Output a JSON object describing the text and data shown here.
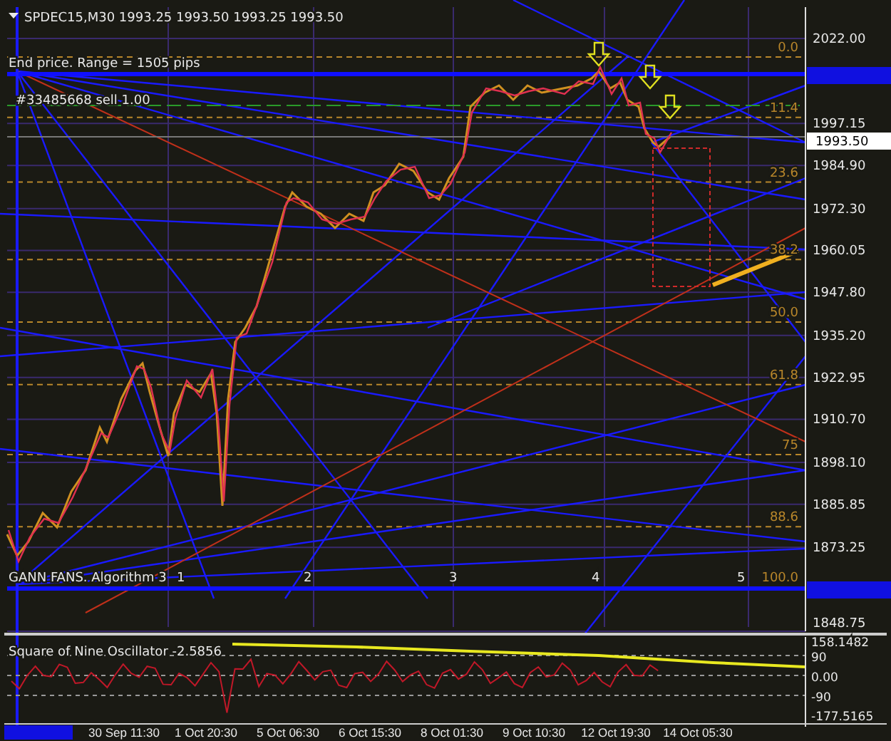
{
  "chart": {
    "symbol_label": "SPDEC15,M30  1993.25 1993.50 1993.25 1993.50",
    "range_label": "End price. Range = 1505 pips",
    "order_label": "#33485668 sell 1.00",
    "fan_label": "GANN FANS. Algorithm 3",
    "wave_labels": [
      "1",
      "2",
      "3",
      "4",
      "5"
    ],
    "fib_levels": [
      "0.0",
      "11.4",
      "23.6",
      "38.2",
      "50.0",
      "61.8",
      "75",
      "88.6",
      "100.0"
    ],
    "price_axis": [
      "2022.00",
      "1997.15",
      "1984.90",
      "1972.30",
      "1960.05",
      "1947.80",
      "1935.20",
      "1922.95",
      "1910.70",
      "1898.10",
      "1885.85",
      "1873.25",
      "1848.75"
    ],
    "current_price": "1993.50"
  },
  "oscillator": {
    "label": "Square of Nine Oscillator -2.5856",
    "axis": [
      "158.1482",
      "90",
      "0.00",
      "-90",
      "-177.5165"
    ]
  },
  "time_axis": [
    "30 Sep 11:30",
    "1 Oct 20:30",
    "5 Oct 06:30",
    "6 Oct 15:30",
    "8 Oct 01:30",
    "9 Oct 10:30",
    "12 Oct 19:30",
    "14 Oct 05:30"
  ]
}
